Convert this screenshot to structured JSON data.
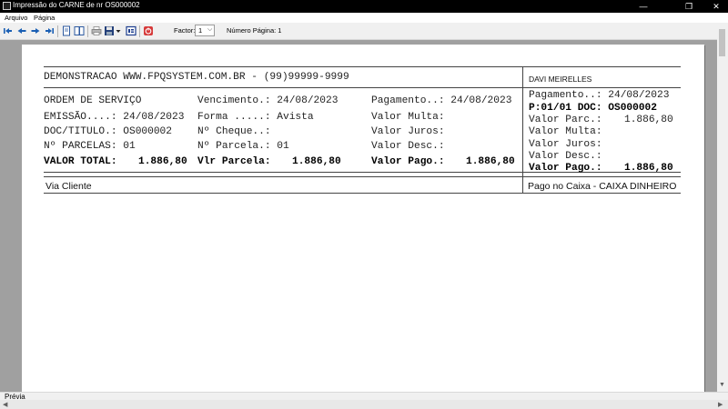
{
  "window": {
    "title": "Impressão do CARNE de nr OS000002",
    "minimize_glyph": "—",
    "maximize_glyph": "❐",
    "close_glyph": "✕"
  },
  "menu": [
    {
      "label": "Arquivo"
    },
    {
      "label": "Página"
    }
  ],
  "toolbar": {
    "factor_label": "Factor:",
    "factor_value": "1",
    "page_number_label": "Número Página: 1",
    "icons": [
      "first-page-icon",
      "prev-page-icon",
      "next-page-icon",
      "last-page-icon",
      "single-page-icon",
      "two-pages-icon",
      "print-icon",
      "save-icon",
      "save-dropdown-icon",
      "export-icon",
      "close-preview-icon"
    ]
  },
  "document": {
    "header_left": "DEMONSTRACAO WWW.FPQSYSTEM.COM.BR - (99)99999-9999",
    "header_right": "DAVI MEIRELLES",
    "rows": [
      [
        "ORDEM DE SERVIÇO",
        "Vencimento.: 24/08/2023",
        "Pagamento..: 24/08/2023"
      ],
      [
        "EMISSÃO....: 24/08/2023",
        "Forma .....: Avista",
        "Valor Multa:"
      ],
      [
        "DOC/TITULO.: OS000002",
        "Nº Cheque..:",
        "Valor Juros:"
      ],
      [
        "Nº PARCELAS: 01",
        "Nº Parcela.: 01",
        "Valor Desc.:"
      ]
    ],
    "totals": {
      "valor_total_label": "VALOR TOTAL:",
      "valor_total": "1.886,80",
      "vlr_parcela_label": "Vlr Parcela:",
      "vlr_parcela": "1.886,80",
      "valor_pago_label": "Valor Pago.:",
      "valor_pago": "1.886,80"
    },
    "right_block": {
      "pagamento": "Pagamento..: 24/08/2023",
      "parcela_doc": "P:01/01 DOC: OS000002",
      "valor_parc_label": "Valor Parc.:",
      "valor_parc": "1.886,80",
      "valor_multa": "Valor Multa:",
      "valor_juros": "Valor Juros:",
      "valor_desc": "Valor Desc.:",
      "valor_pago_label": "Valor Pago.:",
      "valor_pago": "1.886,80"
    },
    "footer_left": "Via Cliente",
    "footer_right": "Pago no Caixa - CAIXA DINHEIRO"
  },
  "status": {
    "text": "Prévia"
  }
}
